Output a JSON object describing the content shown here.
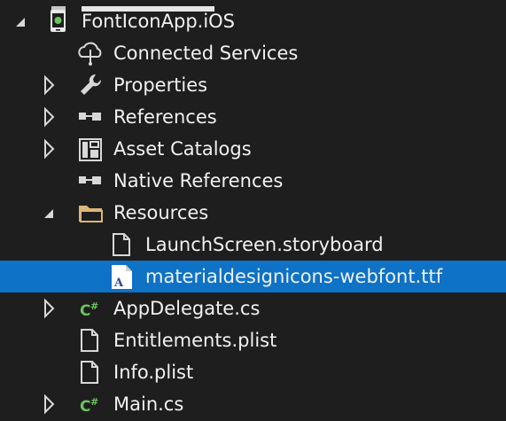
{
  "solution_explorer": {
    "project": {
      "label": "FontIconApp.iOS",
      "expanded": true,
      "icon": "ios-project-icon"
    },
    "items": [
      {
        "label": "Connected Services",
        "icon": "connected-services-icon",
        "expander": "none"
      },
      {
        "label": "Properties",
        "icon": "wrench-icon",
        "expander": "collapsed"
      },
      {
        "label": "References",
        "icon": "references-icon",
        "expander": "collapsed"
      },
      {
        "label": "Asset Catalogs",
        "icon": "asset-catalog-icon",
        "expander": "collapsed"
      },
      {
        "label": "Native References",
        "icon": "references-icon",
        "expander": "none"
      },
      {
        "label": "Resources",
        "icon": "folder-icon",
        "expander": "expanded"
      }
    ],
    "resources_children": [
      {
        "label": "LaunchScreen.storyboard",
        "icon": "file-icon",
        "selected": false
      },
      {
        "label": "materialdesignicons-webfont.ttf",
        "icon": "font-file-icon",
        "selected": true
      }
    ],
    "files": [
      {
        "label": "AppDelegate.cs",
        "icon": "csharp-icon",
        "expander": "collapsed"
      },
      {
        "label": "Entitlements.plist",
        "icon": "file-icon",
        "expander": "none"
      },
      {
        "label": "Info.plist",
        "icon": "file-icon",
        "expander": "none"
      },
      {
        "label": "Main.cs",
        "icon": "csharp-icon",
        "expander": "collapsed"
      }
    ],
    "colors": {
      "background": "#1e1e1e",
      "selection": "#0e72c6",
      "text": "#f1f1f1",
      "csharp_green": "#6bc35f"
    }
  }
}
